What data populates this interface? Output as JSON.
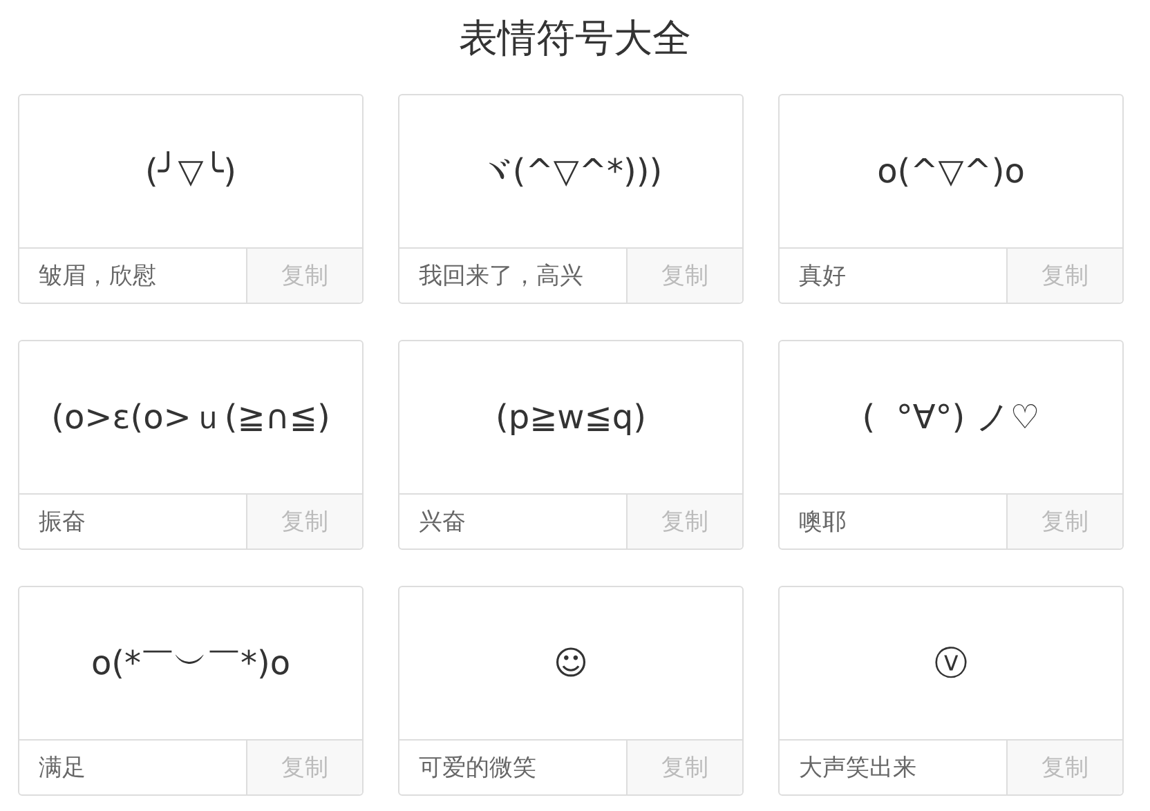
{
  "title": "表情符号大全",
  "cards": [
    {
      "emoticon": "(╯▽╰)",
      "caption": "皱眉，欣慰",
      "button": "复制"
    },
    {
      "emoticon": "ヾ(^▽^*)))",
      "caption": "我回来了，高兴",
      "button": "复制"
    },
    {
      "emoticon": "o(^▽^)o",
      "caption": "真好",
      "button": "复制"
    },
    {
      "emoticon": "(o>ε(o>ｕ(≧∩≦)",
      "caption": "振奋",
      "button": "复制"
    },
    {
      "emoticon": "(p≧w≦q)",
      "caption": "兴奋",
      "button": "复制"
    },
    {
      "emoticon": "(  °∀°) ノ♡",
      "caption": "噢耶",
      "button": "复制"
    },
    {
      "emoticon": "o(*￣︶￣*)o",
      "caption": "满足",
      "button": "复制"
    },
    {
      "emoticon": "☺",
      "caption": "可爱的微笑",
      "button": "复制"
    },
    {
      "emoticon": "ⓥ",
      "caption": "大声笑出来",
      "button": "复制"
    }
  ]
}
